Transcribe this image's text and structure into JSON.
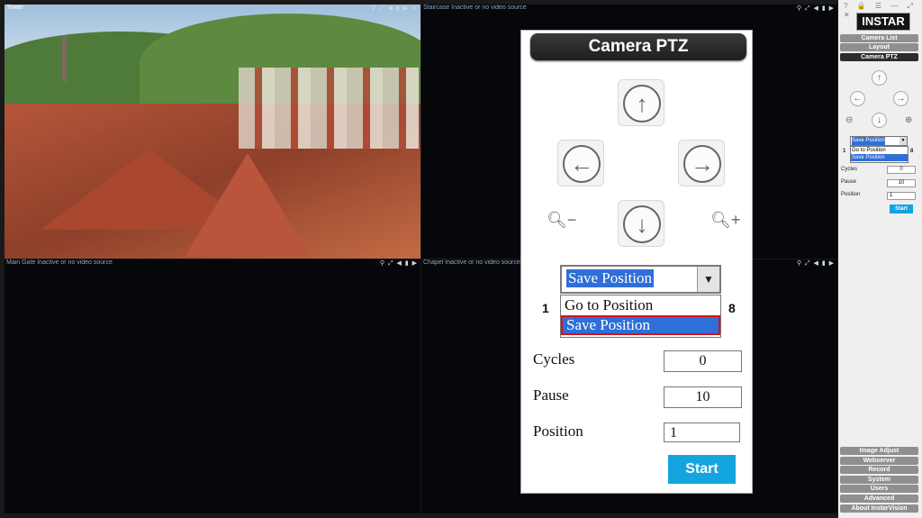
{
  "tiles": [
    {
      "title": "Tower"
    },
    {
      "title": "Staircase Inactive or no video source"
    },
    {
      "title": "Main Gate Inactive or no video source"
    },
    {
      "title": "Chapel Inactive or no video source"
    }
  ],
  "tile_icons": "⚲ ⤢ ◀ ▮ ▶",
  "tile_close": "✕",
  "side_panel": {
    "top_icons": "? 🔒 ☰ — ⤢ ✕",
    "logo": "INSTAR",
    "top_nav": [
      "Camera List",
      "Layout",
      "Camera PTZ"
    ],
    "mini": {
      "select_value": "Save Position",
      "options": [
        "Go to Position",
        "Save Position"
      ],
      "left_num": "1",
      "right_num": "8",
      "cycles_label": "Cycles",
      "cycles_value": "0",
      "pause_label": "Pause",
      "pause_value": "10",
      "position_label": "Position",
      "position_value": "1",
      "start_label": "Start"
    },
    "bottom_nav": [
      "Image Adjust",
      "Webserver",
      "Record",
      "System",
      "Users",
      "Advanced",
      "About InstarVision"
    ]
  },
  "ptz": {
    "title": "Camera PTZ",
    "icons": {
      "up": "↑",
      "left": "←",
      "right": "→",
      "down": "↓",
      "zoom_out": "🔍︎−",
      "zoom_in": "🔍︎+"
    },
    "select_value": "Save Position",
    "options": [
      "Go to Position",
      "Save Position"
    ],
    "left_num": "1",
    "right_num": "8",
    "cycles_label": "Cycles",
    "cycles_value": "0",
    "pause_label": "Pause",
    "pause_value": "10",
    "position_label": "Position",
    "position_value": "1",
    "start_label": "Start"
  },
  "colors": {
    "active_border": "#e89a2e",
    "accent": "#14a4e0",
    "selected": "#2e6fd8",
    "highlight": "#d8121a"
  }
}
